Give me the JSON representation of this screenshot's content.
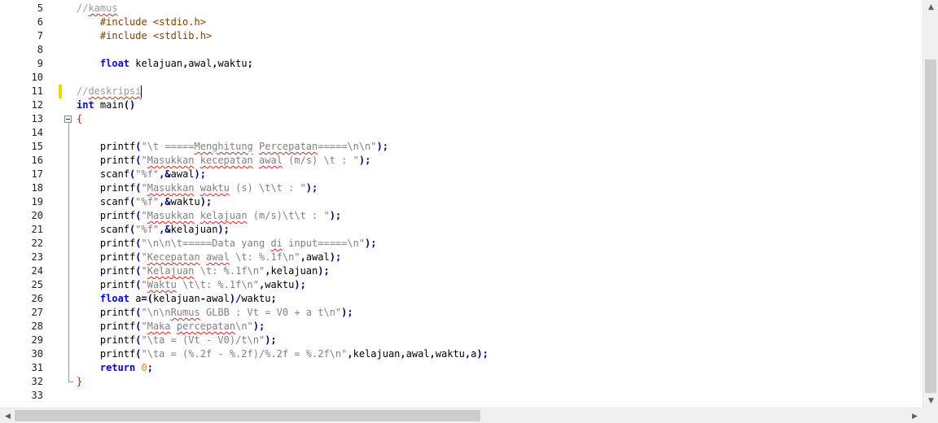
{
  "gutter": {
    "line_numbers": [
      "5",
      "6",
      "7",
      "8",
      "9",
      "10",
      "11",
      "12",
      "13",
      "14",
      "15",
      "16",
      "17",
      "18",
      "19",
      "20",
      "21",
      "22",
      "23",
      "24",
      "25",
      "26",
      "27",
      "28",
      "29",
      "30",
      "31",
      "32",
      "33"
    ]
  },
  "code": {
    "lines": [
      [
        {
          "t": "//",
          "c": "tok-comment-grey"
        },
        {
          "t": "kamus",
          "c": "tok-comment-grey squiggle"
        }
      ],
      [
        {
          "t": "    #include <stdio.h>",
          "c": "tok-pre"
        }
      ],
      [
        {
          "t": "    #include <stdlib.h>",
          "c": "tok-pre"
        }
      ],
      [],
      [
        {
          "t": "    ",
          "c": "tok-plain"
        },
        {
          "t": "float",
          "c": "tok-kw"
        },
        {
          "t": " kelajuan",
          "c": "tok-id"
        },
        {
          "t": ",",
          "c": "tok-op"
        },
        {
          "t": "awal",
          "c": "tok-id"
        },
        {
          "t": ",",
          "c": "tok-op"
        },
        {
          "t": "waktu",
          "c": "tok-id"
        },
        {
          "t": ";",
          "c": "tok-op"
        }
      ],
      [],
      [
        {
          "t": "//",
          "c": "tok-comment-grey"
        },
        {
          "t": "deskripsi",
          "c": "tok-comment-grey squiggle"
        }
      ],
      [
        {
          "t": "int",
          "c": "tok-kw"
        },
        {
          "t": " main",
          "c": "tok-id"
        },
        {
          "t": "()",
          "c": "tok-op"
        }
      ],
      [
        {
          "t": "{",
          "c": "brace"
        }
      ],
      [],
      [
        {
          "t": "    printf",
          "c": "tok-id"
        },
        {
          "t": "(",
          "c": "tok-op"
        },
        {
          "t": "\"\\t =====",
          "c": "tok-str"
        },
        {
          "t": "Menghitung",
          "c": "tok-str squiggle"
        },
        {
          "t": " ",
          "c": "tok-str"
        },
        {
          "t": "Percepatan",
          "c": "tok-str squiggle"
        },
        {
          "t": "=====\\n\\n\"",
          "c": "tok-str"
        },
        {
          "t": ");",
          "c": "tok-op"
        }
      ],
      [
        {
          "t": "    printf",
          "c": "tok-id"
        },
        {
          "t": "(",
          "c": "tok-op"
        },
        {
          "t": "\"",
          "c": "tok-str"
        },
        {
          "t": "Masukkan",
          "c": "tok-str squiggle"
        },
        {
          "t": " ",
          "c": "tok-str"
        },
        {
          "t": "kecepatan",
          "c": "tok-str squiggle"
        },
        {
          "t": " ",
          "c": "tok-str"
        },
        {
          "t": "awal",
          "c": "tok-str squiggle"
        },
        {
          "t": " (m/s) \\t : \"",
          "c": "tok-str"
        },
        {
          "t": ");",
          "c": "tok-op"
        }
      ],
      [
        {
          "t": "    scanf",
          "c": "tok-id"
        },
        {
          "t": "(",
          "c": "tok-op"
        },
        {
          "t": "\"%f\"",
          "c": "tok-str"
        },
        {
          "t": ",&",
          "c": "tok-op"
        },
        {
          "t": "awal",
          "c": "tok-id"
        },
        {
          "t": ");",
          "c": "tok-op"
        }
      ],
      [
        {
          "t": "    printf",
          "c": "tok-id"
        },
        {
          "t": "(",
          "c": "tok-op"
        },
        {
          "t": "\"",
          "c": "tok-str"
        },
        {
          "t": "Masukkan",
          "c": "tok-str squiggle"
        },
        {
          "t": " ",
          "c": "tok-str"
        },
        {
          "t": "waktu",
          "c": "tok-str squiggle"
        },
        {
          "t": " (s) \\t\\t : \"",
          "c": "tok-str"
        },
        {
          "t": ");",
          "c": "tok-op"
        }
      ],
      [
        {
          "t": "    scanf",
          "c": "tok-id"
        },
        {
          "t": "(",
          "c": "tok-op"
        },
        {
          "t": "\"%f\"",
          "c": "tok-str"
        },
        {
          "t": ",&",
          "c": "tok-op"
        },
        {
          "t": "waktu",
          "c": "tok-id"
        },
        {
          "t": ");",
          "c": "tok-op"
        }
      ],
      [
        {
          "t": "    printf",
          "c": "tok-id"
        },
        {
          "t": "(",
          "c": "tok-op"
        },
        {
          "t": "\"",
          "c": "tok-str"
        },
        {
          "t": "Masukkan",
          "c": "tok-str squiggle"
        },
        {
          "t": " ",
          "c": "tok-str"
        },
        {
          "t": "kelajuan",
          "c": "tok-str squiggle"
        },
        {
          "t": " (m/s)\\t\\t : \"",
          "c": "tok-str"
        },
        {
          "t": ");",
          "c": "tok-op"
        }
      ],
      [
        {
          "t": "    scanf",
          "c": "tok-id"
        },
        {
          "t": "(",
          "c": "tok-op"
        },
        {
          "t": "\"%f\"",
          "c": "tok-str"
        },
        {
          "t": ",&",
          "c": "tok-op"
        },
        {
          "t": "kelajuan",
          "c": "tok-id"
        },
        {
          "t": ");",
          "c": "tok-op"
        }
      ],
      [
        {
          "t": "    printf",
          "c": "tok-id"
        },
        {
          "t": "(",
          "c": "tok-op"
        },
        {
          "t": "\"\\n\\n\\t=====Data yang ",
          "c": "tok-str"
        },
        {
          "t": "di",
          "c": "tok-str squiggle"
        },
        {
          "t": " input=====\\n\"",
          "c": "tok-str"
        },
        {
          "t": ");",
          "c": "tok-op"
        }
      ],
      [
        {
          "t": "    printf",
          "c": "tok-id"
        },
        {
          "t": "(",
          "c": "tok-op"
        },
        {
          "t": "\"",
          "c": "tok-str"
        },
        {
          "t": "Kecepatan",
          "c": "tok-str squiggle"
        },
        {
          "t": " ",
          "c": "tok-str"
        },
        {
          "t": "awal",
          "c": "tok-str squiggle"
        },
        {
          "t": " \\t: %.1f\\n\"",
          "c": "tok-str"
        },
        {
          "t": ",",
          "c": "tok-op"
        },
        {
          "t": "awal",
          "c": "tok-id"
        },
        {
          "t": ");",
          "c": "tok-op"
        }
      ],
      [
        {
          "t": "    printf",
          "c": "tok-id"
        },
        {
          "t": "(",
          "c": "tok-op"
        },
        {
          "t": "\"",
          "c": "tok-str"
        },
        {
          "t": "Kelajuan",
          "c": "tok-str squiggle"
        },
        {
          "t": " \\t: %.1f\\n\"",
          "c": "tok-str"
        },
        {
          "t": ",",
          "c": "tok-op"
        },
        {
          "t": "kelajuan",
          "c": "tok-id"
        },
        {
          "t": ");",
          "c": "tok-op"
        }
      ],
      [
        {
          "t": "    printf",
          "c": "tok-id"
        },
        {
          "t": "(",
          "c": "tok-op"
        },
        {
          "t": "\"",
          "c": "tok-str"
        },
        {
          "t": "Waktu",
          "c": "tok-str squiggle"
        },
        {
          "t": " \\t\\t: %.1f\\n\"",
          "c": "tok-str"
        },
        {
          "t": ",",
          "c": "tok-op"
        },
        {
          "t": "waktu",
          "c": "tok-id"
        },
        {
          "t": ");",
          "c": "tok-op"
        }
      ],
      [
        {
          "t": "    ",
          "c": "tok-plain"
        },
        {
          "t": "float",
          "c": "tok-kw"
        },
        {
          "t": " a",
          "c": "tok-id"
        },
        {
          "t": "=(",
          "c": "tok-op"
        },
        {
          "t": "kelajuan",
          "c": "tok-id"
        },
        {
          "t": "-",
          "c": "tok-op"
        },
        {
          "t": "awal",
          "c": "tok-id"
        },
        {
          "t": ")/",
          "c": "tok-op"
        },
        {
          "t": "waktu",
          "c": "tok-id"
        },
        {
          "t": ";",
          "c": "tok-op"
        }
      ],
      [
        {
          "t": "    printf",
          "c": "tok-id"
        },
        {
          "t": "(",
          "c": "tok-op"
        },
        {
          "t": "\"\\n\\n",
          "c": "tok-str"
        },
        {
          "t": "Rumus",
          "c": "tok-str squiggle"
        },
        {
          "t": " GLBB : Vt = V0 + a t\\n\"",
          "c": "tok-str"
        },
        {
          "t": ");",
          "c": "tok-op"
        }
      ],
      [
        {
          "t": "    printf",
          "c": "tok-id"
        },
        {
          "t": "(",
          "c": "tok-op"
        },
        {
          "t": "\"",
          "c": "tok-str"
        },
        {
          "t": "Maka",
          "c": "tok-str squiggle"
        },
        {
          "t": " ",
          "c": "tok-str"
        },
        {
          "t": "percepatan",
          "c": "tok-str squiggle"
        },
        {
          "t": "\\n\"",
          "c": "tok-str"
        },
        {
          "t": ");",
          "c": "tok-op"
        }
      ],
      [
        {
          "t": "    printf",
          "c": "tok-id"
        },
        {
          "t": "(",
          "c": "tok-op"
        },
        {
          "t": "\"\\ta = (Vt - V0)/t\\n\"",
          "c": "tok-str"
        },
        {
          "t": ");",
          "c": "tok-op"
        }
      ],
      [
        {
          "t": "    printf",
          "c": "tok-id"
        },
        {
          "t": "(",
          "c": "tok-op"
        },
        {
          "t": "\"\\ta = (%.2f - %.2f)/%.2f = %.2f\\n\"",
          "c": "tok-str"
        },
        {
          "t": ",",
          "c": "tok-op"
        },
        {
          "t": "kelajuan",
          "c": "tok-id"
        },
        {
          "t": ",",
          "c": "tok-op"
        },
        {
          "t": "awal",
          "c": "tok-id"
        },
        {
          "t": ",",
          "c": "tok-op"
        },
        {
          "t": "waktu",
          "c": "tok-id"
        },
        {
          "t": ",",
          "c": "tok-op"
        },
        {
          "t": "a",
          "c": "tok-id"
        },
        {
          "t": ");",
          "c": "tok-op"
        }
      ],
      [
        {
          "t": "    ",
          "c": "tok-plain"
        },
        {
          "t": "return",
          "c": "tok-kw"
        },
        {
          "t": " ",
          "c": "tok-plain"
        },
        {
          "t": "0",
          "c": "tok-num"
        },
        {
          "t": ";",
          "c": "tok-op"
        }
      ],
      [
        {
          "t": "}",
          "c": "brace"
        }
      ],
      []
    ]
  },
  "scrollbars": {
    "up_arrow": "▲",
    "down_arrow": "▼",
    "left_arrow": "◀",
    "right_arrow": "▶"
  }
}
